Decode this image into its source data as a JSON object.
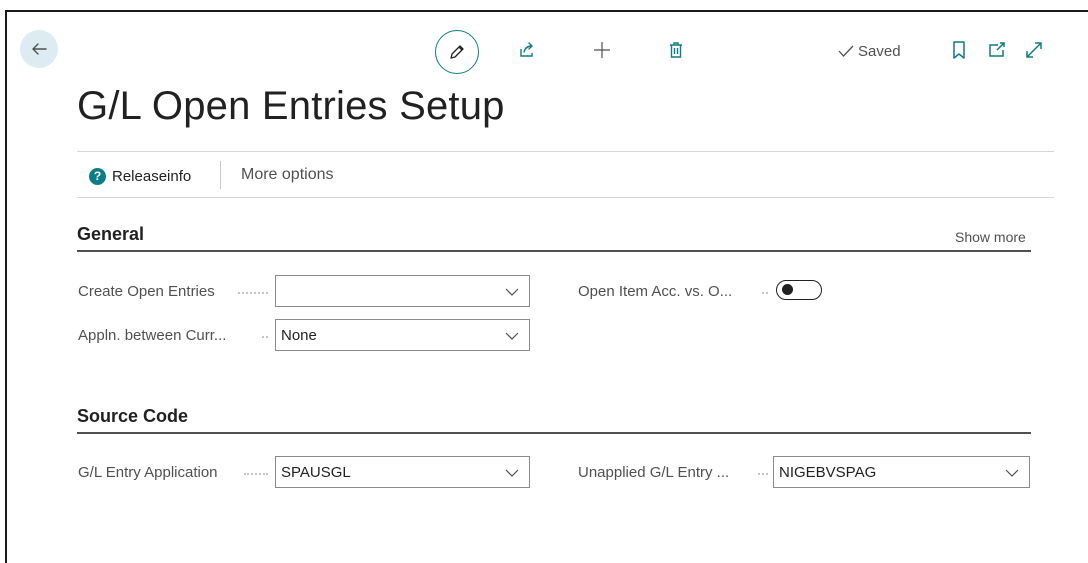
{
  "toolbar": {
    "saved_label": "Saved"
  },
  "page": {
    "title": "G/L Open Entries Setup"
  },
  "actions": {
    "releaseinfo_label": "Releaseinfo",
    "more_options_label": "More options"
  },
  "general": {
    "title": "General",
    "show_more_label": "Show more",
    "create_open_entries_label": "Create Open Entries",
    "create_open_entries_value": "",
    "appln_between_curr_label": "Appln. between Curr...",
    "appln_between_curr_value": "None",
    "open_item_acc_label": "Open Item Acc. vs. O...",
    "open_item_acc_value": "off"
  },
  "source_code": {
    "title": "Source Code",
    "gl_entry_application_label": "G/L Entry Application",
    "gl_entry_application_value": "SPAUSGL",
    "unapplied_gl_entry_label": "Unapplied G/L Entry ...",
    "unapplied_gl_entry_value": "NIGEBVSPAG"
  },
  "colors": {
    "accent": "#0e7c86",
    "back_button_bg": "#dcecf2",
    "text": "#212121",
    "muted_text": "#505050"
  },
  "icons": {
    "back": "arrow-left-icon",
    "edit": "pencil-icon",
    "share": "share-icon",
    "new": "plus-icon",
    "delete": "trash-icon",
    "saved": "checkmark-icon",
    "bookmark": "bookmark-icon",
    "popout": "open-in-new-window-icon",
    "expand": "expand-icon",
    "help": "help-icon",
    "dropdown": "chevron-down-icon"
  }
}
